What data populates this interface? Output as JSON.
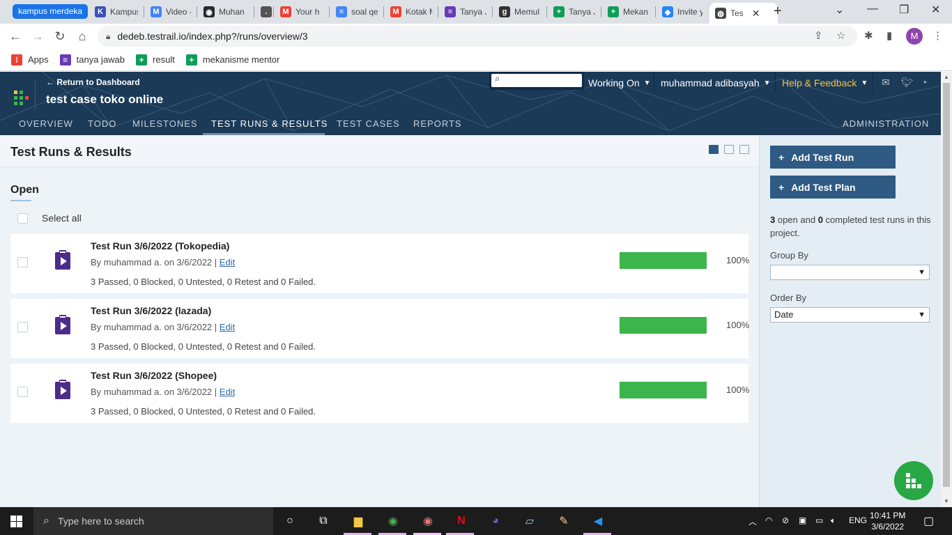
{
  "browser": {
    "tab_group_label": "kampus merdeka",
    "tabs": [
      {
        "label": "Kampus",
        "color": "#3f51b5",
        "glyph": "K"
      },
      {
        "label": "Video -",
        "color": "#4285f4",
        "glyph": "M"
      },
      {
        "label": "Muhan",
        "color": "#24292e",
        "glyph": "◉"
      },
      {
        "label": "",
        "color": "#555555",
        "glyph": "."
      },
      {
        "label": "Your h",
        "color": "#ea4335",
        "glyph": "M"
      },
      {
        "label": "soal qe",
        "color": "#4285f4",
        "glyph": "≡"
      },
      {
        "label": "Kotak M",
        "color": "#ea4335",
        "glyph": "M"
      },
      {
        "label": "Tanya J",
        "color": "#673ab7",
        "glyph": "≡"
      },
      {
        "label": "Memul",
        "color": "#333333",
        "glyph": "g"
      },
      {
        "label": "Tanya J",
        "color": "#0f9d58",
        "glyph": "+"
      },
      {
        "label": "Mekan",
        "color": "#0f9d58",
        "glyph": "+"
      },
      {
        "label": "Invite y",
        "color": "#2684ff",
        "glyph": "◆"
      },
      {
        "label": "Tes",
        "color": "#444444",
        "glyph": "◍"
      }
    ],
    "url": "dedeb.testrail.io/index.php?/runs/overview/3",
    "profile_initial": "M",
    "bookmarks": [
      {
        "label": "Apps",
        "color": "#ea4335",
        "glyph": "⁝"
      },
      {
        "label": "tanya jawab",
        "color": "#673ab7",
        "glyph": "≡"
      },
      {
        "label": "result",
        "color": "#0f9d58",
        "glyph": "+"
      },
      {
        "label": "mekanisme mentor",
        "color": "#0f9d58",
        "glyph": "+"
      }
    ]
  },
  "header": {
    "return_link": "← Return to Dashboard",
    "project_title": "test case toko online",
    "working_on": "Working On",
    "user_name": "muhammad adibasyah",
    "help": "Help & Feedback",
    "nav": [
      "OVERVIEW",
      "TODO",
      "MILESTONES",
      "TEST RUNS & RESULTS",
      "TEST CASES",
      "REPORTS"
    ],
    "admin": "ADMINISTRATION"
  },
  "main": {
    "page_title": "Test Runs & Results",
    "section_title": "Open",
    "select_all": "Select all",
    "runs": [
      {
        "title": "Test Run 3/6/2022 (Tokopedia)",
        "meta": "By muhammad a. on 3/6/2022 |",
        "edit": "Edit",
        "stats": "3 Passed, 0 Blocked, 0 Untested, 0 Retest and 0 Failed.",
        "progress": 100,
        "pct_label": "100%"
      },
      {
        "title": "Test Run 3/6/2022 (lazada)",
        "meta": "By muhammad a. on 3/6/2022 |",
        "edit": "Edit",
        "stats": "3 Passed, 0 Blocked, 0 Untested, 0 Retest and 0 Failed.",
        "progress": 100,
        "pct_label": "100%"
      },
      {
        "title": "Test Run 3/6/2022 (Shopee)",
        "meta": "By muhammad a. on 3/6/2022 |",
        "edit": "Edit",
        "stats": "3 Passed, 0 Blocked, 0 Untested, 0 Retest and 0 Failed.",
        "progress": 100,
        "pct_label": "100%"
      }
    ]
  },
  "sidebar": {
    "add_run": "Add Test Run",
    "add_plan": "Add Test Plan",
    "open_count": "3",
    "summary_mid": " open and ",
    "completed_count": "0",
    "summary_end": " completed test runs in this project.",
    "group_by_label": "Group By",
    "group_by_value": "",
    "order_by_label": "Order By",
    "order_by_value": "Date"
  },
  "taskbar": {
    "search_placeholder": "Type here to search",
    "language": "ENG",
    "time": "10:41 PM",
    "date": "3/6/2022"
  },
  "colors": {
    "header_bg": "#1b3a57",
    "progress_passed": "#3cb54a",
    "button_bg": "#2e5a83",
    "help_text": "#f5c242"
  }
}
